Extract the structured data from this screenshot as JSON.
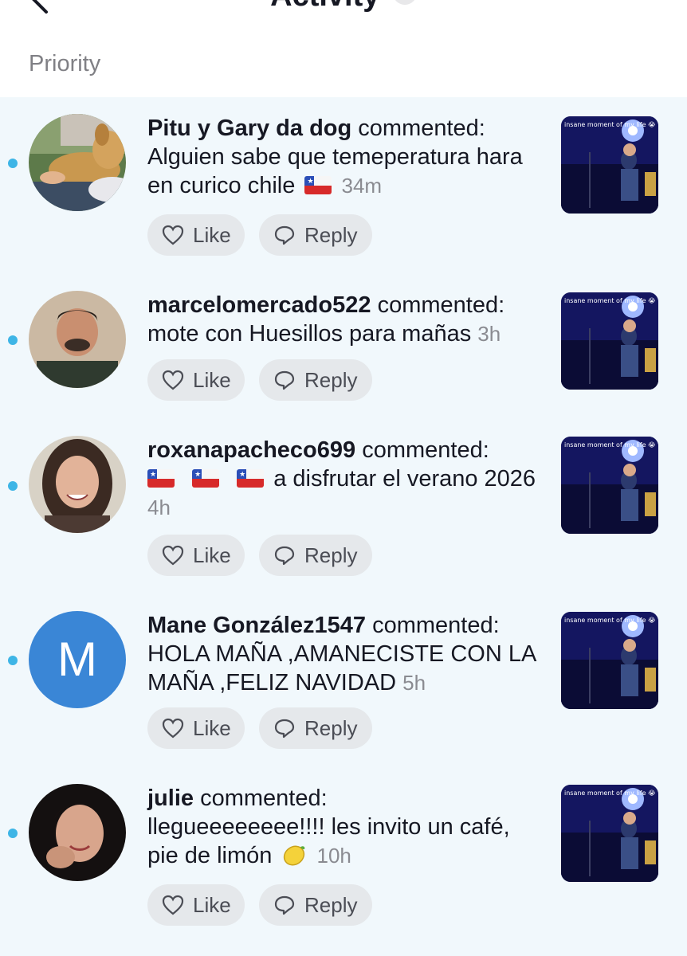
{
  "header": {
    "title": "Activity"
  },
  "section": {
    "label": "Priority"
  },
  "buttons": {
    "like_label": "Like",
    "reply_label": "Reply"
  },
  "thumbnail": {
    "caption": "insane moment of my life 😭"
  },
  "colors": {
    "unread_dot": "#3eb5e6",
    "feed_bg": "#f1f8fc",
    "avatar_letter_bg": "#3a86d6",
    "pill_bg": "#e5e8eb"
  },
  "icons": {
    "back": "back-chevron-icon",
    "like": "heart-outline-icon",
    "reply": "speech-bubble-icon",
    "flag": "chile-flag-icon",
    "lemon": "lemon-icon"
  },
  "notifications": [
    {
      "username": "Pitu y Gary da dog",
      "action": "commented:",
      "comment": "Alguien sabe que temeperatura hara en curico chile",
      "emoji_after": "🇨🇱",
      "time": "34m",
      "unread": true
    },
    {
      "username": "marcelomercado522",
      "action": "commented:",
      "comment": "mote con Huesillos para mañas",
      "time": "3h",
      "unread": true
    },
    {
      "username": "roxanapacheco699",
      "action": "commented:",
      "emoji_before": "🇨🇱🇨🇱🇨🇱",
      "comment": "a disfrutar el verano 2026",
      "time": "4h",
      "unread": true
    },
    {
      "username": "Mane González1547",
      "action": "commented:",
      "comment": "HOLA MAÑA ,AMANECISTE CON LA MAÑA ,FELIZ NAVIDAD",
      "avatar_letter": "M",
      "time": "5h",
      "unread": true
    },
    {
      "username": "julie",
      "action": "commented:",
      "comment": "llegueeeeeeee!!!! les invito un café, pie de limón",
      "emoji_after": "🍋",
      "time": "10h",
      "unread": true
    }
  ]
}
